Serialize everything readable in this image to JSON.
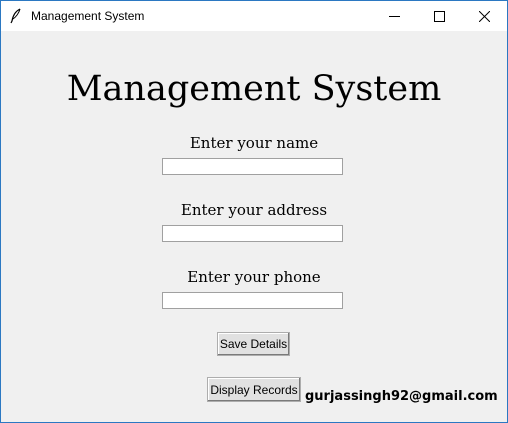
{
  "window": {
    "title": "Management System",
    "controls": {
      "minimize": "minimize-icon",
      "maximize": "maximize-icon",
      "close": "close-icon"
    },
    "app_icon": "feather-icon"
  },
  "form": {
    "heading": "Management System",
    "name_label": "Enter your name",
    "name_value": "",
    "address_label": "Enter your address",
    "address_value": "",
    "phone_label": "Enter your phone",
    "phone_value": "",
    "save_button": "Save Details",
    "display_button": "Display Records"
  },
  "footer": {
    "email": "gurjassingh92@gmail.com"
  },
  "colors": {
    "background": "#f0f0f0",
    "titlebar": "#ffffff",
    "border": "#2b78c2",
    "button": "#e1e1e1"
  }
}
